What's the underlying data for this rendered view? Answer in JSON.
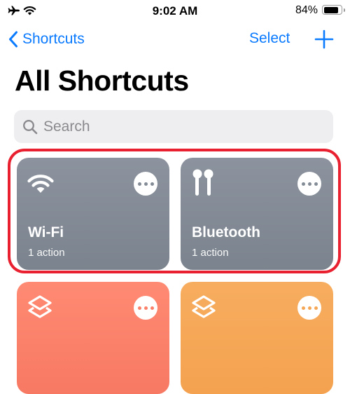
{
  "status_bar": {
    "time": "9:02 AM",
    "battery": "84%",
    "battery_level": 0.84
  },
  "nav": {
    "back_label": "Shortcuts",
    "select_label": "Select"
  },
  "page": {
    "title": "All Shortcuts"
  },
  "search": {
    "placeholder": "Search"
  },
  "cards": [
    {
      "name": "Wi-Fi",
      "sub": "1 action",
      "icon": "wifi-icon",
      "color": "#838b96"
    },
    {
      "name": "Bluetooth",
      "sub": "1 action",
      "icon": "airpods-icon",
      "color": "#838b96"
    },
    {
      "name": "",
      "sub": "",
      "icon": "shortcuts-icon",
      "color": "#fb8069"
    },
    {
      "name": "",
      "sub": "",
      "icon": "shortcuts-icon",
      "color": "#f5a755"
    }
  ],
  "colors": {
    "accent": "#0a7aff",
    "highlight": "#e8202f"
  }
}
